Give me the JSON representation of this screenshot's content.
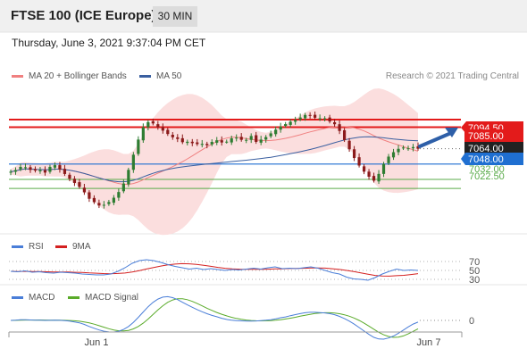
{
  "header": {
    "instrument": "FTSE 100 (ICE Europe)",
    "timeframe": "30 MIN"
  },
  "datetime": "Thursday, June 3, 2021 9:37:04 PM CET",
  "credit": "Research © 2021 Trading Central",
  "colors": {
    "up_candle": "#2e7d32",
    "down_candle": "#8b1a1a",
    "ma20": "#f08080",
    "ma50": "#3a5fa0",
    "bb_fill": "#fbdede",
    "resistance": "#e31b1b",
    "support_blue": "#1f6fd1",
    "support_green": "#5aab4a",
    "arrow": "#2e5fa8",
    "rsi": "#4a7ed8",
    "rsi_ma": "#d42020",
    "macd": "#4a7ed8",
    "macd_signal": "#5aab2a"
  },
  "chart_data": [
    {
      "type": "candlestick",
      "legend": [
        {
          "name": "MA 20 + Bollinger Bands",
          "color": "#f08080"
        },
        {
          "name": "MA 50",
          "color": "#3a5fa0"
        }
      ],
      "ylim": [
        6990,
        7115
      ],
      "x_ticks": [
        "Jun 1",
        "Jun 7"
      ],
      "levels": [
        {
          "label": "7094.50",
          "value": 7094.5,
          "style": "resistance",
          "color": "#e31b1b"
        },
        {
          "label": "7085.00",
          "value": 7086.5,
          "style": "resistance",
          "color": "#e31b1b"
        },
        {
          "label": "7064.00",
          "value": 7064,
          "style": "last",
          "color": "#222222"
        },
        {
          "label": "7048.00",
          "value": 7048,
          "style": "pivot",
          "color": "#1f6fd1"
        },
        {
          "label": "7032.00",
          "value": 7032,
          "style": "support",
          "color": "#5aab4a"
        },
        {
          "label": "7022.50",
          "value": 7022.5,
          "style": "support",
          "color": "#5aab4a"
        }
      ],
      "close_path": [
        7040,
        7042,
        7046,
        7044,
        7040,
        7043,
        7038,
        7045,
        7047,
        7041,
        7036,
        7030,
        7026,
        7020,
        7012,
        7008,
        7004,
        7006,
        7010,
        7016,
        7024,
        7040,
        7058,
        7076,
        7090,
        7093,
        7088,
        7084,
        7080,
        7076,
        7074,
        7070,
        7072,
        7068,
        7070,
        7067,
        7071,
        7073,
        7070,
        7072,
        7077,
        7074,
        7072,
        7078,
        7071,
        7074,
        7077,
        7082,
        7086,
        7089,
        7092,
        7094,
        7097,
        7100,
        7098,
        7095,
        7097,
        7093,
        7090,
        7082,
        7071,
        7060,
        7050,
        7042,
        7036,
        7030,
        7038,
        7050,
        7058,
        7062,
        7066,
        7064,
        7066,
        7064
      ]
    },
    {
      "type": "line",
      "series": [
        {
          "name": "RSI",
          "color": "#4a7ed8"
        },
        {
          "name": "9MA",
          "color": "#d42020"
        }
      ],
      "levels": [
        70,
        50,
        30
      ],
      "rsi": [
        48,
        47,
        49,
        46,
        47,
        45,
        44,
        46,
        45,
        44,
        42,
        41,
        40,
        40,
        42,
        48,
        56,
        66,
        72,
        74,
        72,
        68,
        63,
        59,
        56,
        53,
        55,
        52,
        54,
        52,
        50,
        52,
        51,
        53,
        55,
        53,
        56,
        58,
        54,
        55,
        54,
        56,
        58,
        55,
        50,
        45,
        42,
        35,
        31,
        30,
        28,
        34,
        42,
        48,
        53,
        50,
        51,
        50
      ]
    },
    {
      "type": "line",
      "series": [
        {
          "name": "MACD",
          "color": "#4a7ed8"
        },
        {
          "name": "MACD Signal",
          "color": "#5aab2a"
        }
      ],
      "levels": [
        0
      ]
    }
  ]
}
